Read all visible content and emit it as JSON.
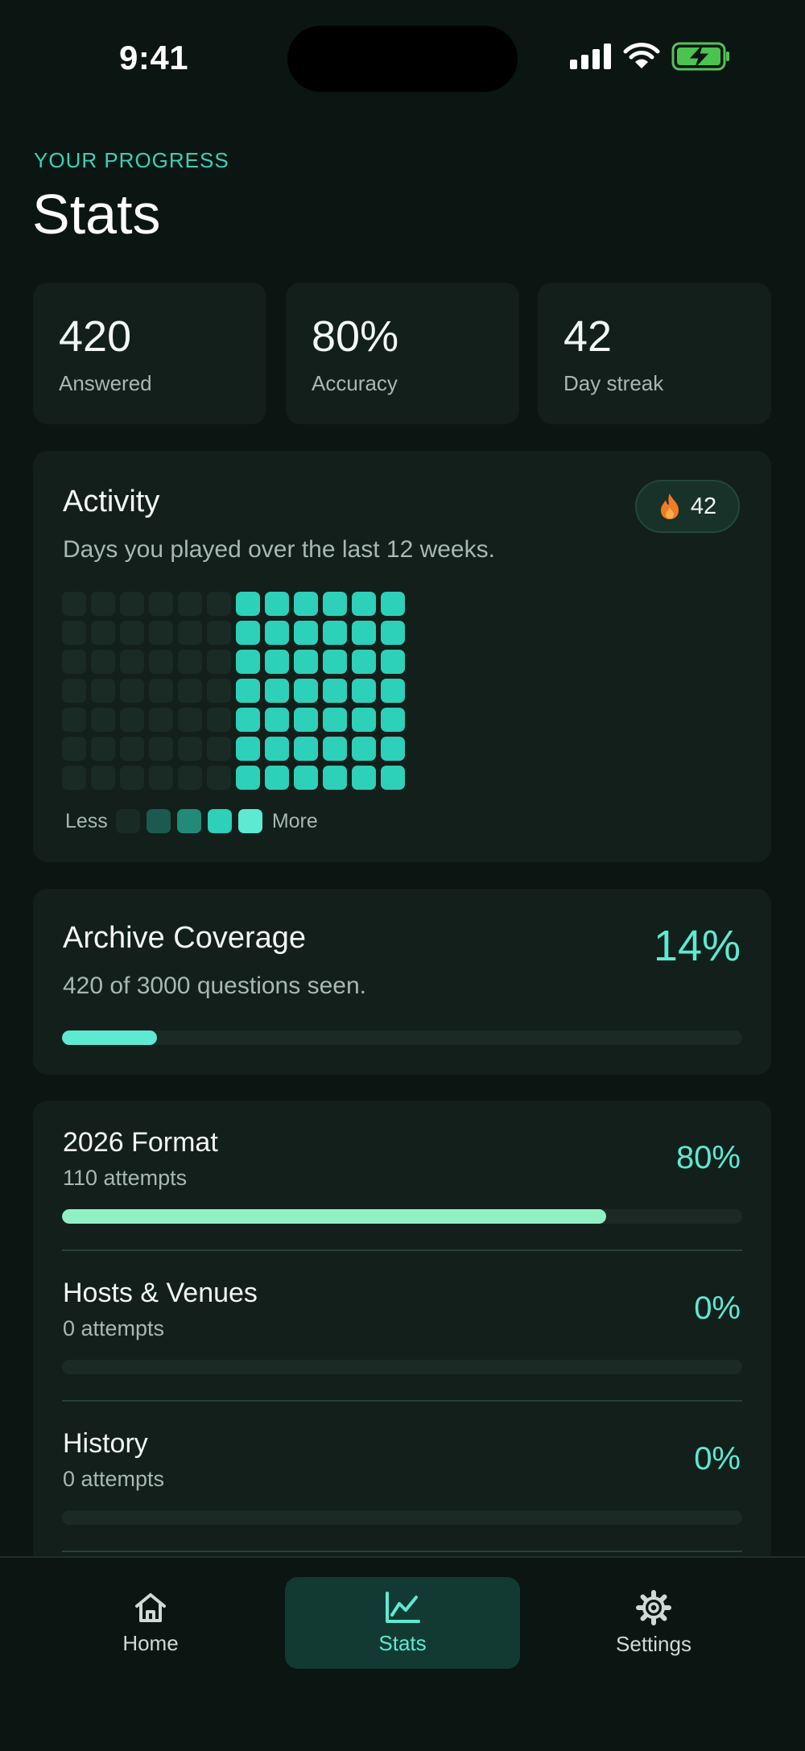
{
  "status_bar": {
    "time": "9:41"
  },
  "header": {
    "kicker": "YOUR PROGRESS",
    "title": "Stats"
  },
  "stats": [
    {
      "value": "420",
      "label": "Answered"
    },
    {
      "value": "80%",
      "label": "Accuracy"
    },
    {
      "value": "42",
      "label": "Day streak"
    }
  ],
  "activity": {
    "title": "Activity",
    "subtitle": "Days you played over the last 12 weeks.",
    "streak_badge": "42",
    "legend_less": "Less",
    "legend_more": "More",
    "heatmap_levels": [
      [
        0,
        0,
        0,
        0,
        0,
        0,
        3,
        3,
        3,
        3,
        3,
        3
      ],
      [
        0,
        0,
        0,
        0,
        0,
        0,
        3,
        3,
        3,
        3,
        3,
        3
      ],
      [
        0,
        0,
        0,
        0,
        0,
        0,
        3,
        3,
        3,
        3,
        3,
        3
      ],
      [
        0,
        0,
        0,
        0,
        0,
        0,
        3,
        3,
        3,
        3,
        3,
        3
      ],
      [
        0,
        0,
        0,
        0,
        0,
        0,
        3,
        3,
        3,
        3,
        3,
        3
      ],
      [
        0,
        0,
        0,
        0,
        0,
        0,
        3,
        3,
        3,
        3,
        3,
        3
      ],
      [
        0,
        0,
        0,
        0,
        0,
        0,
        3,
        3,
        3,
        3,
        3,
        3
      ]
    ],
    "level_colors": [
      "#1a2a25",
      "#1c5a4f",
      "#228a79",
      "#2dd0b8",
      "#5ee9d2"
    ]
  },
  "coverage": {
    "title": "Archive Coverage",
    "subtitle": "420 of 3000 questions seen.",
    "percent_label": "14%",
    "progress": 0.14,
    "bar_color": "#5ee9d2"
  },
  "categories": [
    {
      "name": "2026 Format",
      "attempts": "110 attempts",
      "percent_label": "80%",
      "progress": 0.8
    },
    {
      "name": "Hosts & Venues",
      "attempts": "0 attempts",
      "percent_label": "0%",
      "progress": 0
    },
    {
      "name": "History",
      "attempts": "0 attempts",
      "percent_label": "0%",
      "progress": 0
    }
  ],
  "tabs": [
    {
      "label": "Home",
      "icon": "home-icon"
    },
    {
      "label": "Stats",
      "icon": "chart-icon",
      "active": true
    },
    {
      "label": "Settings",
      "icon": "gear-icon"
    }
  ],
  "colors": {
    "accent": "#5ee9d2",
    "category_bar": "#8ff0c4",
    "background": "#0b1512",
    "card": "#121f1b"
  }
}
